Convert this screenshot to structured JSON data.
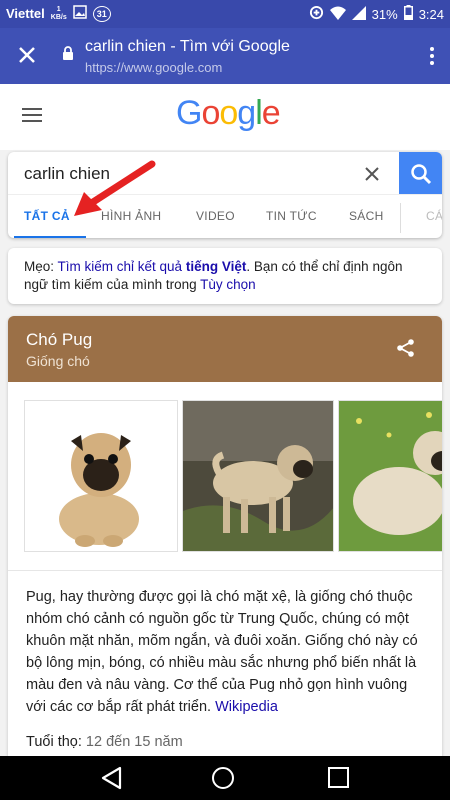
{
  "status_bar": {
    "carrier": "Viettel",
    "speed_value": "1",
    "speed_unit": "KB/s",
    "notification_count": "31",
    "battery": "31%",
    "time": "3:24"
  },
  "browser": {
    "page_title": "carlin chien - Tìm với Google",
    "url": "https://www.google.com"
  },
  "search": {
    "query": "carlin chien",
    "tabs": [
      {
        "label": "TẤT CẢ",
        "active": true
      },
      {
        "label": "HÌNH ẢNH"
      },
      {
        "label": "VIDEO"
      },
      {
        "label": "TIN TỨC"
      },
      {
        "label": "SÁCH"
      },
      {
        "label": "CÁ"
      }
    ]
  },
  "tip": {
    "prefix": "Mẹo: ",
    "link1": "Tìm kiếm chỉ kết quả",
    "link1_bold": "tiếng Việt",
    "middle": ". Bạn có thể chỉ định ngôn ngữ tìm kiếm của mình trong ",
    "link2": "Tùy chọn"
  },
  "knowledge": {
    "title": "Chó Pug",
    "subtitle": "Giống chó",
    "description": "Pug, hay thường được gọi là chó mặt xệ, là giống chó thuộc nhóm chó cảnh có nguồn gốc từ Trung Quốc, chúng có một khuôn mặt nhăn, mõm ngắn, và đuôi xoăn. Giống chó này có bộ lông mịn, bóng, có nhiều màu sắc nhưng phổ biến nhất là màu đen và nâu vàng. Cơ thể của Pug nhỏ gọn hình vuông với các cơ bắp rất phát triển. ",
    "source": "Wikipedia",
    "lifespan_label": "Tuổi thọ: ",
    "lifespan_value": "12 đến 15 năm"
  },
  "colors": {
    "status_bar": "#3949ab",
    "toolbar": "#3f51b5",
    "card_header": "#9b7047",
    "accent": "#1a73e8",
    "link": "#1a0dab"
  }
}
